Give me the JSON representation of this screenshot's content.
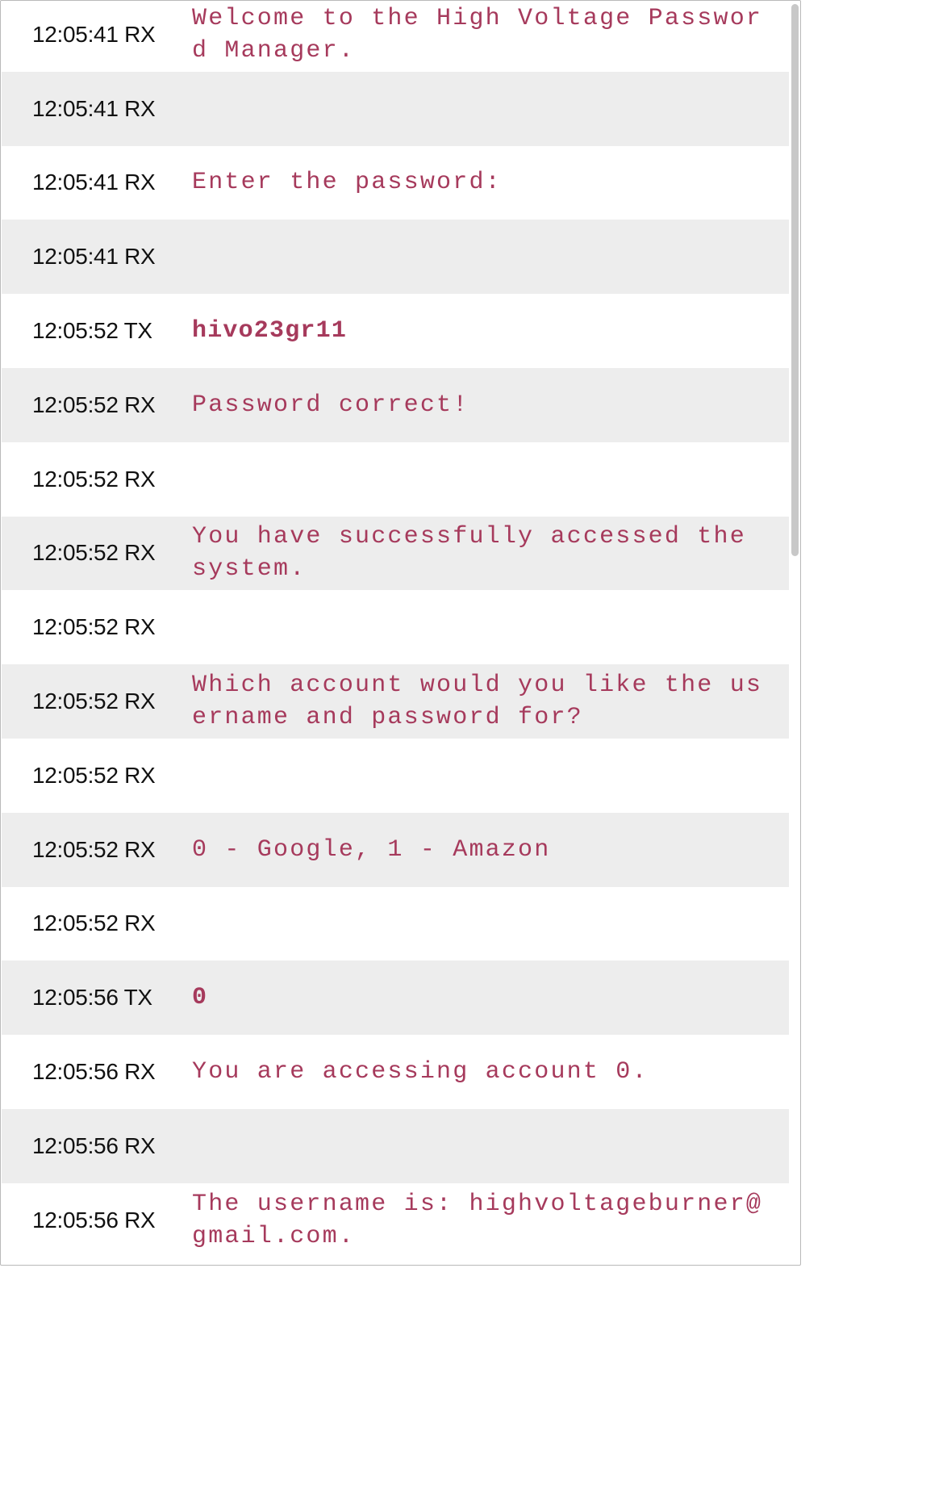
{
  "log": {
    "rows": [
      {
        "time": "12:05:41",
        "dir": "RX",
        "text": "Welcome to the High Voltage Password Manager."
      },
      {
        "time": "12:05:41",
        "dir": "RX",
        "text": ""
      },
      {
        "time": "12:05:41",
        "dir": "RX",
        "text": "Enter the password:"
      },
      {
        "time": "12:05:41",
        "dir": "RX",
        "text": ""
      },
      {
        "time": "12:05:52",
        "dir": "TX",
        "text": "hivo23gr11"
      },
      {
        "time": "12:05:52",
        "dir": "RX",
        "text": "Password correct!"
      },
      {
        "time": "12:05:52",
        "dir": "RX",
        "text": ""
      },
      {
        "time": "12:05:52",
        "dir": "RX",
        "text": "You have successfully accessed the system."
      },
      {
        "time": "12:05:52",
        "dir": "RX",
        "text": ""
      },
      {
        "time": "12:05:52",
        "dir": "RX",
        "text": "Which account would you like the username and password for?"
      },
      {
        "time": "12:05:52",
        "dir": "RX",
        "text": ""
      },
      {
        "time": "12:05:52",
        "dir": "RX",
        "text": "0 - Google, 1 - Amazon"
      },
      {
        "time": "12:05:52",
        "dir": "RX",
        "text": ""
      },
      {
        "time": "12:05:56",
        "dir": "TX",
        "text": "0"
      },
      {
        "time": "12:05:56",
        "dir": "RX",
        "text": "You are accessing account 0."
      },
      {
        "time": "12:05:56",
        "dir": "RX",
        "text": ""
      },
      {
        "time": "12:05:56",
        "dir": "RX",
        "text": "The username is: highvoltageburner@gmail.com."
      }
    ]
  },
  "colors": {
    "message_text": "#a63a5c",
    "timestamp_text": "#111111",
    "row_alt_background": "#ededed"
  }
}
